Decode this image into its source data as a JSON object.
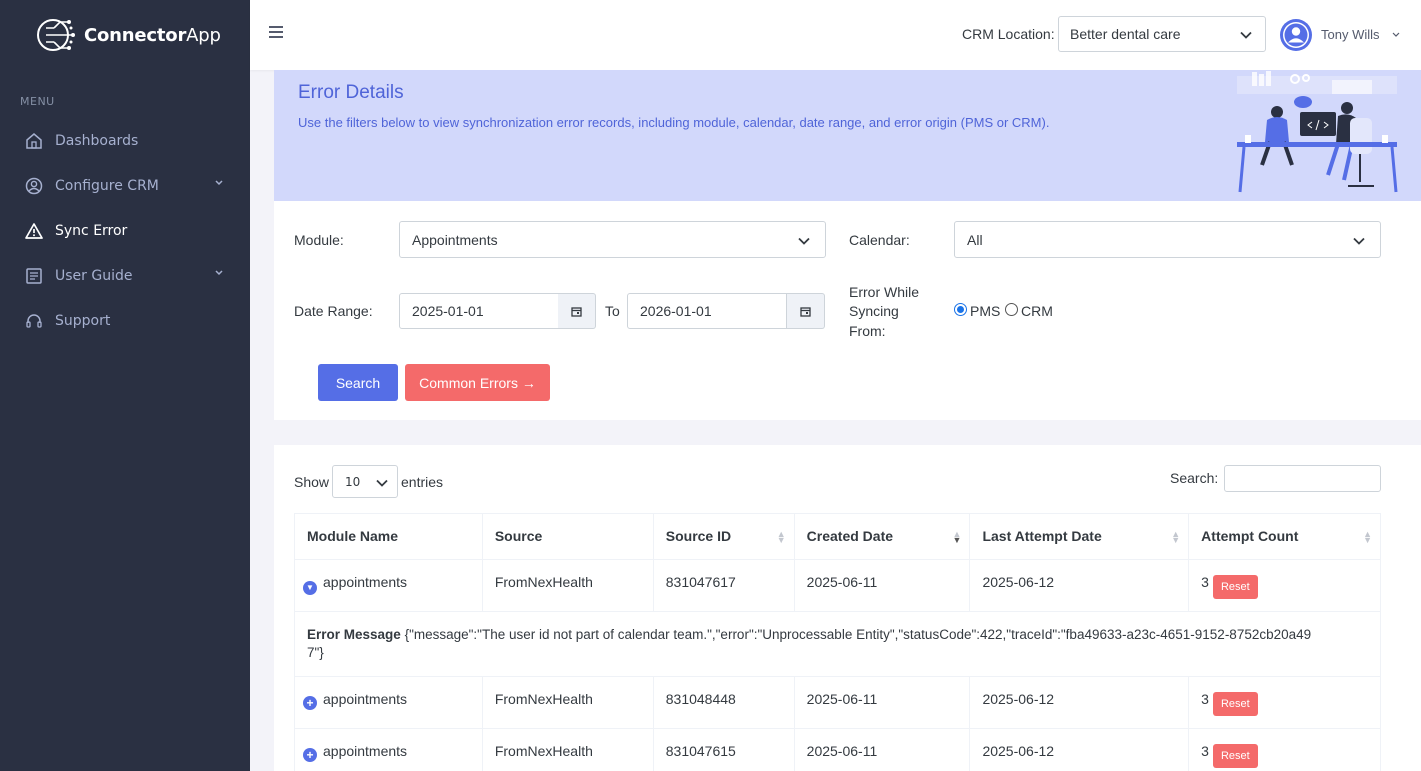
{
  "brand": {
    "name_bold": "Connector",
    "name_light": "App"
  },
  "sidebar": {
    "menu_title": "MENU",
    "items": [
      {
        "label": "Dashboards",
        "icon": "home-icon"
      },
      {
        "label": "Configure CRM",
        "icon": "user-circle-icon"
      },
      {
        "label": "Sync Error",
        "icon": "warning-icon"
      },
      {
        "label": "User Guide",
        "icon": "document-icon"
      },
      {
        "label": "Support",
        "icon": "headset-icon"
      }
    ]
  },
  "topbar": {
    "crm_label": "CRM Location:",
    "crm_value": "Better dental care",
    "user_name": "Tony Wills"
  },
  "banner": {
    "title": "Error Details",
    "subtitle": "Use the filters below to view synchronization error records, including module, calendar, date range, and error origin (PMS or CRM)."
  },
  "filters": {
    "module_label": "Module:",
    "module_value": "Appointments",
    "calendar_label": "Calendar:",
    "calendar_value": "All",
    "date_range_label": "Date Range:",
    "date_from": "2025-01-01",
    "to_label": "To",
    "date_to": "2026-01-01",
    "error_from_label_1": "Error While",
    "error_from_label_2": "Syncing",
    "error_from_label_3": "From:",
    "option_pms": "PMS",
    "option_crm": "CRM",
    "search_button": "Search",
    "common_errors_button": "Common Errors →"
  },
  "table": {
    "show_label": "Show",
    "entries_value": "10",
    "entries_label": "entries",
    "search_label": "Search:",
    "columns": [
      "Module Name",
      "Source",
      "Source ID",
      "Created Date",
      "Last Attempt Date",
      "Attempt Count"
    ],
    "reset_label": "Reset",
    "error_message_label": "Error Message",
    "rows": [
      {
        "module": "appointments",
        "source": "FromNexHealth",
        "source_id": "831047617",
        "created": "2025-06-11",
        "last_attempt": "2025-06-12",
        "attempts": "3",
        "error_message_1": "{\"message\":\"The user id not part of calendar team.\",\"error\":\"Unprocessable Entity\",\"statusCode\":422,\"traceId\":\"fba49633-a23c-4651-9152-8752cb20a49",
        "error_message_2": "7\"}"
      },
      {
        "module": "appointments",
        "source": "FromNexHealth",
        "source_id": "831048448",
        "created": "2025-06-11",
        "last_attempt": "2025-06-12",
        "attempts": "3"
      },
      {
        "module": "appointments",
        "source": "FromNexHealth",
        "source_id": "831047615",
        "created": "2025-06-11",
        "last_attempt": "2025-06-12",
        "attempts": "3"
      }
    ]
  }
}
